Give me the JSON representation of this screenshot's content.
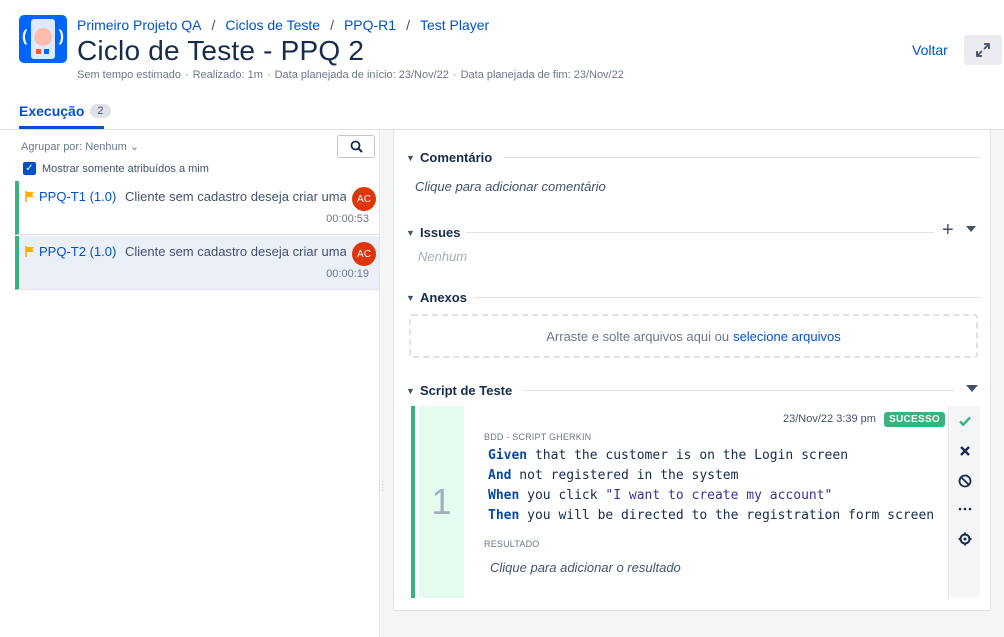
{
  "breadcrumbs": [
    "Primeiro Projeto QA",
    "Ciclos de Teste",
    "PPQ-R1",
    "Test Player"
  ],
  "title": "Ciclo de Teste - PPQ 2",
  "meta": {
    "estimated": "Sem tempo estimado",
    "realized": "Realizado: 1m",
    "start": "Data planejada de início: 23/Nov/22",
    "end": "Data planejada de fim: 23/Nov/22"
  },
  "header": {
    "back_label": "Voltar",
    "expand_icon": "expand-icon"
  },
  "tabs": [
    {
      "label": "Execução",
      "count": "2"
    }
  ],
  "left": {
    "group_by": "Agrupar por: Nenhum",
    "only_mine_label": "Mostrar somente atribuídos a mim",
    "only_mine_checked": true,
    "items": [
      {
        "key": "PPQ-T1 (1.0)",
        "summary": "Cliente sem cadastro deseja criar uma conta",
        "avatar": "AC",
        "time": "00:00:53",
        "status_color": "#36b37e",
        "flag_color": "#ffab00"
      },
      {
        "key": "PPQ-T2 (1.0)",
        "summary": "Cliente sem cadastro deseja criar uma conta",
        "avatar": "AC",
        "time": "00:00:19",
        "status_color": "#36b37e",
        "flag_color": "#ffab00"
      }
    ]
  },
  "sections": {
    "comment": {
      "title": "Comentário",
      "placeholder": "Clique para adicionar comentário"
    },
    "issues": {
      "title": "Issues",
      "empty": "Nenhum"
    },
    "attachments": {
      "title": "Anexos",
      "drop_text": "Arraste e solte arquivos aqui ou",
      "select_link": "selecione arquivos"
    },
    "script": {
      "title": "Script de Teste"
    }
  },
  "step": {
    "number": "1",
    "date": "23/Nov/22 3:39 pm",
    "status": "SUCESSO",
    "bdd_label": "BDD - SCRIPT GHERKIN",
    "lines": [
      {
        "kw": "Given",
        "text": " that the customer is on the Login screen"
      },
      {
        "kw": "And",
        "text": " not registered in the system"
      },
      {
        "kw": "When",
        "text": " you click ",
        "str": "\"I want to create my account\""
      },
      {
        "kw": "Then",
        "text": " you will be directed to the registration form screen"
      }
    ],
    "result_label": "RESULTADO",
    "result_placeholder": "Clique para adicionar o resultado",
    "actions": [
      "check-icon",
      "close-icon",
      "block-icon",
      "more-icon",
      "settings-icon"
    ]
  },
  "colors": {
    "accent": "#0052cc",
    "success": "#36b37e",
    "avatar": "#de350b"
  }
}
